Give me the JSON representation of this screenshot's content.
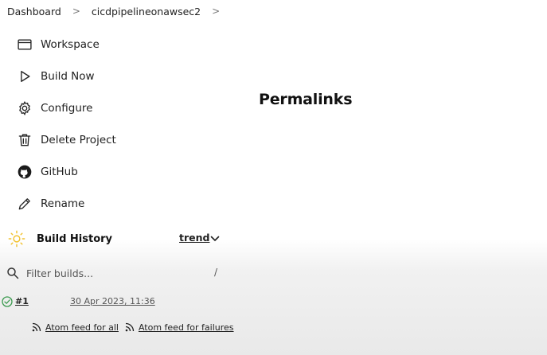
{
  "breadcrumb": {
    "items": [
      "Dashboard",
      "cicdpipelineonawsec2"
    ],
    "separator": ">"
  },
  "tasks": [
    {
      "label": "Workspace",
      "icon": "folder-icon"
    },
    {
      "label": "Build Now",
      "icon": "play-icon"
    },
    {
      "label": "Configure",
      "icon": "gear-icon"
    },
    {
      "label": "Delete Project",
      "icon": "trash-icon"
    },
    {
      "label": "GitHub",
      "icon": "github-icon"
    },
    {
      "label": "Rename",
      "icon": "pencil-icon"
    }
  ],
  "build_history": {
    "title": "Build History",
    "trend_label": "trend",
    "filter_placeholder": "Filter builds...",
    "filter_shortcut": "/",
    "builds": [
      {
        "number": "#1",
        "date": "30 Apr 2023, 11:36",
        "status": "success"
      }
    ],
    "feeds": {
      "all": "Atom feed for all",
      "failures": "Atom feed for failures"
    }
  },
  "main": {
    "title": "Permalinks"
  },
  "colors": {
    "success": "#3a9a4e",
    "sun": "#f2c230"
  }
}
